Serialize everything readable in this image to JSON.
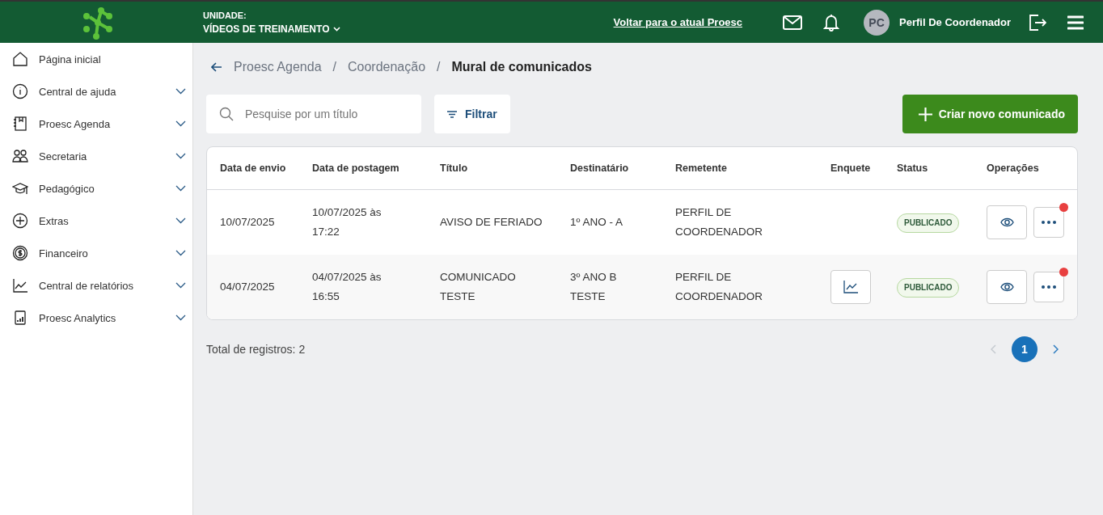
{
  "header": {
    "unit_label": "UNIDADE:",
    "unit_name": "VÍDEOS DE TREINAMENTO",
    "back_link": "Voltar para o atual Proesc",
    "avatar_initials": "PC",
    "profile_name": "Perfil De Coordenador"
  },
  "sidebar": {
    "items": [
      {
        "label": "Página inicial",
        "expandable": false
      },
      {
        "label": "Central de ajuda",
        "expandable": true
      },
      {
        "label": "Proesc Agenda",
        "expandable": true
      },
      {
        "label": "Secretaria",
        "expandable": true
      },
      {
        "label": "Pedagógico",
        "expandable": true
      },
      {
        "label": "Extras",
        "expandable": true
      },
      {
        "label": "Financeiro",
        "expandable": true
      },
      {
        "label": "Central de relatórios",
        "expandable": true
      },
      {
        "label": "Proesc Analytics",
        "expandable": true
      }
    ]
  },
  "breadcrumb": [
    {
      "label": "Proesc Agenda",
      "current": false
    },
    {
      "separator": "/",
      "label": "Coordenação",
      "current": false
    },
    {
      "separator": "/",
      "label": "Mural de comunicados",
      "current": true
    }
  ],
  "search": {
    "placeholder": "Pesquise por um título"
  },
  "filter_button": "Filtrar",
  "create_button": "Criar novo comunicado",
  "table": {
    "columns": [
      "Data de envio",
      "Data de postagem",
      "Título",
      "Destinatário",
      "Remetente",
      "Enquete",
      "Status",
      "Operações"
    ],
    "rows": [
      {
        "sent": "10/07/2025",
        "posted": "10/07/2025 às 17:22",
        "title": "AVISO DE FERIADO",
        "recipient": "1º ANO - A",
        "sender": "PERFIL DE COORDENADOR",
        "poll": false,
        "status": "PUBLICADO",
        "notification": true
      },
      {
        "sent": "04/07/2025",
        "posted": "04/07/2025 às 16:55",
        "title": "COMUNICADO TESTE",
        "recipient": "3º ANO B TESTE",
        "sender": "PERFIL DE COORDENADOR",
        "poll": true,
        "status": "PUBLICADO",
        "notification": true
      }
    ]
  },
  "total": "Total de registros: 2",
  "pagination": [
    {
      "label": "1",
      "selected": true
    }
  ]
}
